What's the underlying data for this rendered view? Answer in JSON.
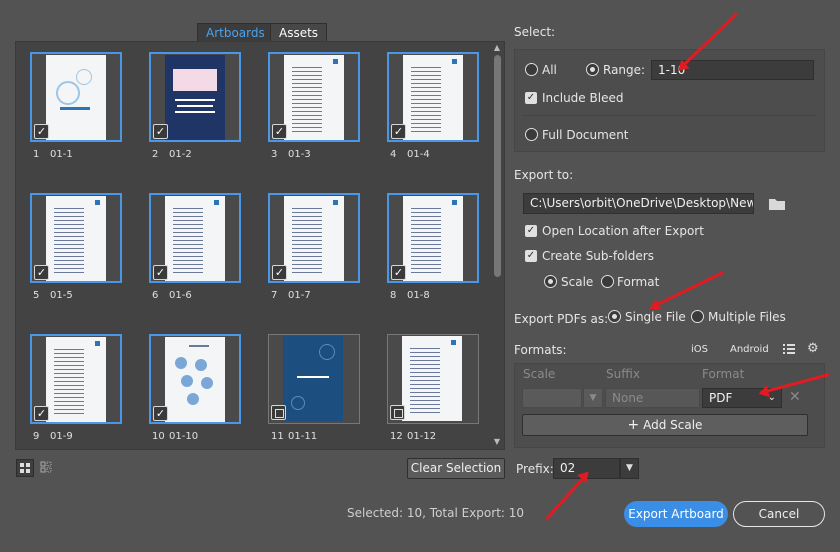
{
  "tabs": {
    "artboards": "Artboards",
    "assets": "Assets"
  },
  "artboards": [
    {
      "num": "1",
      "name": "01-1",
      "selected": true,
      "style": "cover"
    },
    {
      "num": "2",
      "name": "01-2",
      "selected": true,
      "style": "dark"
    },
    {
      "num": "3",
      "name": "01-3",
      "selected": true,
      "style": "text"
    },
    {
      "num": "4",
      "name": "01-4",
      "selected": true,
      "style": "text"
    },
    {
      "num": "5",
      "name": "01-5",
      "selected": true,
      "style": "text"
    },
    {
      "num": "6",
      "name": "01-6",
      "selected": true,
      "style": "text"
    },
    {
      "num": "7",
      "name": "01-7",
      "selected": true,
      "style": "text"
    },
    {
      "num": "8",
      "name": "01-8",
      "selected": true,
      "style": "text"
    },
    {
      "num": "9",
      "name": "01-9",
      "selected": true,
      "style": "text"
    },
    {
      "num": "10",
      "name": "01-10",
      "selected": true,
      "style": "diagram"
    },
    {
      "num": "11",
      "name": "01-11",
      "selected": false,
      "style": "blue"
    },
    {
      "num": "12",
      "name": "01-12",
      "selected": false,
      "style": "text"
    }
  ],
  "clear_selection": "Clear Selection",
  "status": "Selected: 10, Total Export: 10",
  "select": {
    "title": "Select:",
    "all": "All",
    "range": "Range:",
    "range_value": "1-10",
    "include_bleed": "Include Bleed",
    "full_document": "Full Document"
  },
  "export_to": {
    "title": "Export to:",
    "path": "C:\\Users\\orbit\\OneDrive\\Desktop\\New fo",
    "open_location": "Open Location after Export",
    "create_subfolders": "Create Sub-folders",
    "scale": "Scale",
    "format": "Format"
  },
  "export_pdfs": {
    "title": "Export PDFs as:",
    "single": "Single File",
    "multiple": "Multiple Files"
  },
  "formats": {
    "title": "Formats:",
    "ios": "iOS",
    "android": "Android",
    "col_scale": "Scale",
    "col_suffix": "Suffix",
    "col_format": "Format",
    "suffix_placeholder": "None",
    "format_value": "PDF",
    "add_scale": "Add Scale"
  },
  "prefix": {
    "label": "Prefix:",
    "value": "02"
  },
  "buttons": {
    "export": "Export Artboard",
    "cancel": "Cancel"
  },
  "colors": {
    "accent": "#4a97e8",
    "annotation": "#e21b23",
    "panel": "#535353"
  }
}
